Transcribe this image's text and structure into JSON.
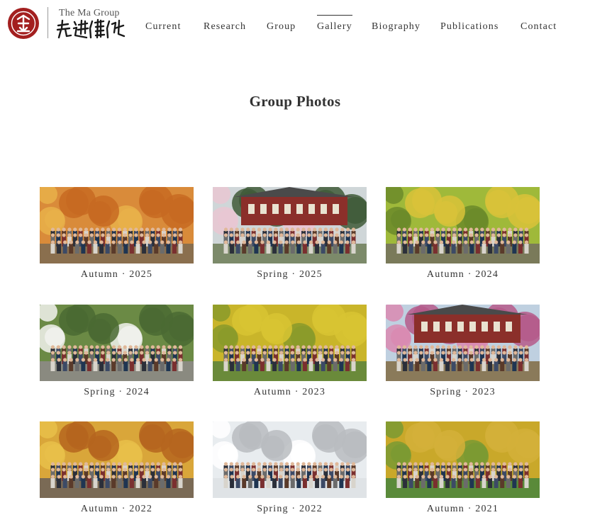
{
  "brand": {
    "group_name": "The Ma Group",
    "calligraphy": "先进催化",
    "seal_color": "#a31f1f"
  },
  "nav": {
    "items": [
      {
        "label": "Current",
        "active": false
      },
      {
        "label": "Research",
        "active": false
      },
      {
        "label": "Group",
        "active": false
      },
      {
        "label": "Gallery",
        "active": true
      },
      {
        "label": "Biography",
        "active": false
      },
      {
        "label": "Publications",
        "active": false
      },
      {
        "label": "Contact",
        "active": false
      }
    ]
  },
  "page": {
    "title": "Group Photos"
  },
  "gallery": [
    {
      "caption": "Autumn · 2025",
      "season": "autumn",
      "palette": {
        "sky": "#d98b3a",
        "trees": "#c76a22",
        "accent": "#e8b04a",
        "ground": "#8a6f4e"
      }
    },
    {
      "caption": "Spring · 2025",
      "season": "spring-building",
      "palette": {
        "sky": "#cfd6d8",
        "trees": "#3f5a38",
        "accent": "#e9c7d2",
        "ground": "#7c8a6a"
      }
    },
    {
      "caption": "Autumn · 2024",
      "season": "ginkgo",
      "palette": {
        "sky": "#9fb93a",
        "trees": "#d9c23a",
        "accent": "#6b8a2a",
        "ground": "#7a7a5a"
      }
    },
    {
      "caption": "Spring · 2024",
      "season": "blossom",
      "palette": {
        "sky": "#6b8a45",
        "trees": "#4a6a33",
        "accent": "#f2f2ee",
        "ground": "#8a8a80"
      }
    },
    {
      "caption": "Autumn · 2023",
      "season": "ginkgo",
      "palette": {
        "sky": "#c9b52a",
        "trees": "#d8c433",
        "accent": "#8a9a2a",
        "ground": "#6a8a3a"
      }
    },
    {
      "caption": "Spring · 2023",
      "season": "spring-building",
      "palette": {
        "sky": "#bfd0e0",
        "trees": "#b55a8a",
        "accent": "#d98ab0",
        "ground": "#8a7a5a"
      }
    },
    {
      "caption": "Autumn · 2022",
      "season": "autumn",
      "palette": {
        "sky": "#d9a63a",
        "trees": "#b5651e",
        "accent": "#e8c04a",
        "ground": "#7a6a55"
      }
    },
    {
      "caption": "Spring · 2022",
      "season": "snow",
      "palette": {
        "sky": "#e8ecef",
        "trees": "#b8bcc0",
        "accent": "#ffffff",
        "ground": "#dfe3e6"
      }
    },
    {
      "caption": "Autumn · 2021",
      "season": "ginkgo",
      "palette": {
        "sky": "#c9a82a",
        "trees": "#d4b03a",
        "accent": "#7a9a33",
        "ground": "#5a8a3a"
      }
    }
  ]
}
